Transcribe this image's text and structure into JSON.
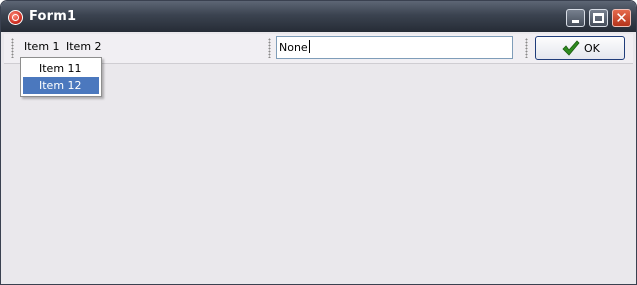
{
  "window": {
    "title": "Form1",
    "icon": "app-icon",
    "controls": [
      "minimize-icon",
      "maximize-icon",
      "close-icon"
    ]
  },
  "menubar": {
    "items": [
      {
        "label": "Item 1"
      },
      {
        "label": "Item 2"
      }
    ]
  },
  "dropdown": {
    "items": [
      {
        "label": "Item 11",
        "selected": false
      },
      {
        "label": "Item 12",
        "selected": true
      }
    ]
  },
  "textbox": {
    "value": "None"
  },
  "ok_button": {
    "label": "OK",
    "icon": "checkmark-icon",
    "icon_color": "#2e8b1f"
  },
  "colors": {
    "titlebar": "#3b4350",
    "highlight": "#4b78be",
    "background": "#eae8ec"
  }
}
